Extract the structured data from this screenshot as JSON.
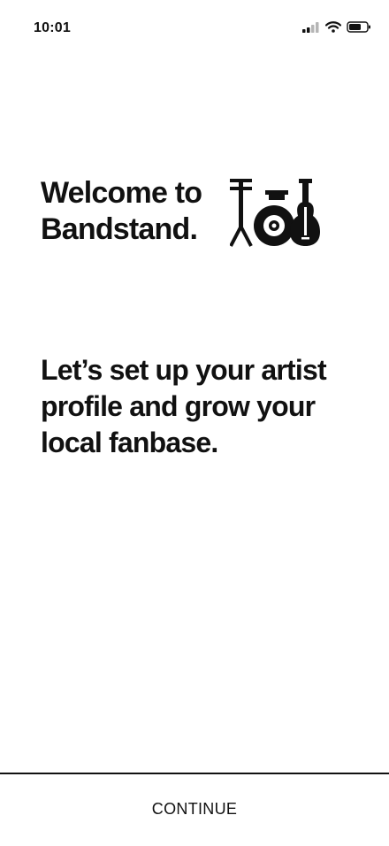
{
  "status_bar": {
    "time": "10:01",
    "icons": [
      "cellular-signal-icon",
      "wifi-icon",
      "battery-icon"
    ]
  },
  "welcome": {
    "heading": "Welcome to\nBandstand.",
    "logo_icon": "drum-kit-guitar-icon"
  },
  "tagline": "Let’s set up your artist\nprofile and grow your\nlocal fanbase.",
  "footer": {
    "continue_label": "CONTINUE"
  },
  "colors": {
    "background": "#ffffff",
    "foreground": "#111111",
    "inactive_signal": "#b5b5b5"
  }
}
